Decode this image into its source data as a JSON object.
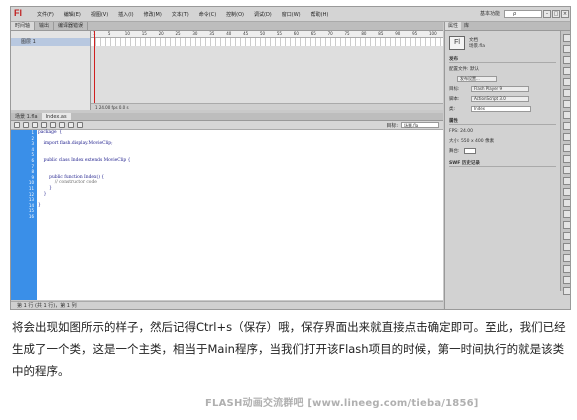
{
  "app": {
    "logo": "Fl",
    "menus": [
      "文件(F)",
      "编辑(E)",
      "视图(V)",
      "插入(I)",
      "修改(M)",
      "文本(T)",
      "命令(C)",
      "控制(O)",
      "调试(D)",
      "窗口(W)",
      "帮助(H)"
    ],
    "workspace": "基本功能",
    "search_placeholder": "ρ"
  },
  "timeline": {
    "tabs": [
      "时间轴",
      "输出",
      "编译器错误"
    ],
    "layer": "图层 1",
    "ruler": [
      "1",
      "5",
      "10",
      "15",
      "20",
      "25",
      "30",
      "35",
      "40",
      "45",
      "50",
      "55",
      "60",
      "65",
      "70",
      "75",
      "80",
      "85",
      "90",
      "95",
      "100"
    ],
    "foot": "1  24.00 fps  0.0 s"
  },
  "doc": {
    "tabs": [
      "场景 1.fla",
      "Index.as"
    ],
    "target_label": "目标:",
    "target_value": "场景.fla"
  },
  "code": {
    "line_numbers": [
      "1",
      "2",
      "3",
      "4",
      "5",
      "6",
      "7",
      "8",
      "9",
      "10",
      "11",
      "12",
      "13",
      "14",
      "15",
      "16"
    ],
    "lines": [
      {
        "t": "package  {",
        "c": false
      },
      {
        "t": "",
        "c": false
      },
      {
        "t": "    import flash.display.MovieClip;",
        "c": false
      },
      {
        "t": "",
        "c": false
      },
      {
        "t": "",
        "c": false
      },
      {
        "t": "    public class Index extends MovieClip {",
        "c": false
      },
      {
        "t": "",
        "c": false
      },
      {
        "t": "",
        "c": false
      },
      {
        "t": "        public function Index() {",
        "c": false
      },
      {
        "t": "            // constructor code",
        "c": true
      },
      {
        "t": "        }",
        "c": false
      },
      {
        "t": "    }",
        "c": false
      },
      {
        "t": "",
        "c": false
      },
      {
        "t": "}",
        "c": false
      },
      {
        "t": "",
        "c": false
      },
      {
        "t": "",
        "c": false
      }
    ]
  },
  "status": "第 1 行 (共 1 行)，第 1 列",
  "properties": {
    "tabs": [
      "属性",
      "库"
    ],
    "doc_title": "文档",
    "doc_name": "场景.fla",
    "sect_publish": "发布",
    "config": "配置文件: 默认",
    "publish_btn": "发布设置...",
    "player_label": "目标:",
    "player": "Flash Player 9",
    "script_label": "脚本:",
    "script": "ActionScript 3.0",
    "class_label": "类:",
    "class_value": "Index",
    "sect_props": "属性",
    "fps": "FPS: 24.00",
    "size": "大小: 550 x 400 像素",
    "stage": "舞台:",
    "sect_history": "SWF 历史记录"
  },
  "caption": "将会出现如图所示的样子，然后记得Ctrl+s（保存）哦，保存界面出来就直接点击确定即可。至此，我们已经生成了一个类，这是一个主类，相当于Main程序，当我们打开该Flash项目的时候，第一时间执行的就是该类中的程序。",
  "watermark": "FLASH动画交流群吧 [www.lineeg.com/tieba/1856]"
}
